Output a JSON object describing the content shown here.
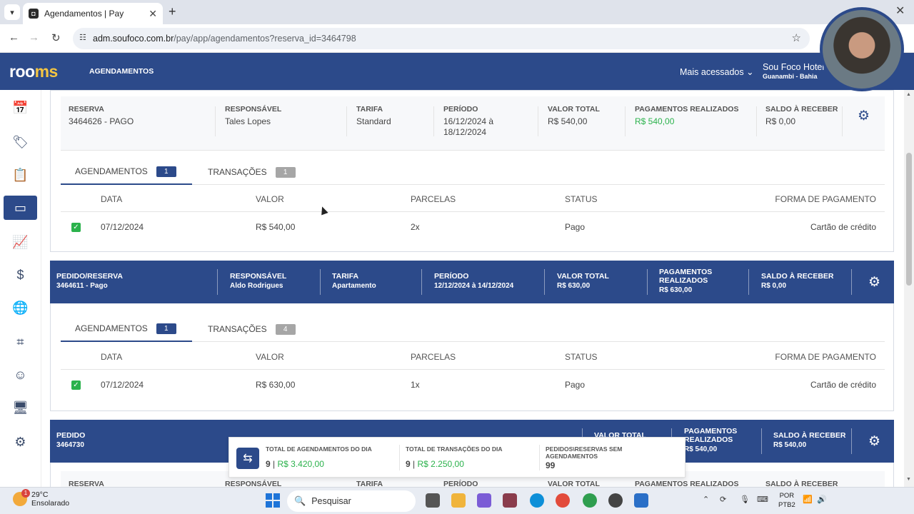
{
  "browser": {
    "tab_title": "Agendamentos | Pay",
    "url_host": "adm.soufoco.com.br",
    "url_path": "/pay/app/agendamentos?reserva_id=3464798"
  },
  "header": {
    "logo_a": "roo",
    "logo_b": "ms",
    "nav_label": "AGENDAMENTOS",
    "mais_acessados": "Mais acessados",
    "hotel_name": "Sou Foco Hotel",
    "hotel_city": "Guanambi - Bahia"
  },
  "card1": {
    "fields": [
      {
        "label": "RESERVA",
        "value": "3464626 - PAGO"
      },
      {
        "label": "RESPONSÁVEL",
        "value": "Tales Lopes"
      },
      {
        "label": "TARIFA",
        "value": "Standard"
      },
      {
        "label": "PERÍODO",
        "value": "16/12/2024 à 18/12/2024"
      },
      {
        "label": "VALOR TOTAL",
        "value": "R$ 540,00"
      },
      {
        "label": "PAGAMENTOS REALIZADOS",
        "value": "R$ 540,00"
      },
      {
        "label": "SALDO À RECEBER",
        "value": "R$ 0,00"
      }
    ],
    "tab_agendamentos": "AGENDAMENTOS",
    "tab_agendamentos_count": "1",
    "tab_transacoes": "TRANSAÇÕES",
    "tab_transacoes_count": "1",
    "columns": [
      "DATA",
      "VALOR",
      "PARCELAS",
      "STATUS",
      "FORMA DE PAGAMENTO"
    ],
    "row": {
      "data": "07/12/2024",
      "valor": "R$ 540,00",
      "parcelas": "2x",
      "status": "Pago",
      "forma": "Cartão de crédito"
    }
  },
  "card2": {
    "fields": [
      {
        "label": "PEDIDO/RESERVA",
        "value": "3464611 - Pago"
      },
      {
        "label": "RESPONSÁVEL",
        "value": "Aldo Rodrigues"
      },
      {
        "label": "TARIFA",
        "value": "Apartamento"
      },
      {
        "label": "PERÍODO",
        "value": "12/12/2024 à 14/12/2024"
      },
      {
        "label": "VALOR TOTAL",
        "value": "R$ 630,00"
      },
      {
        "label": "PAGAMENTOS REALIZADOS",
        "value": "R$ 630,00"
      },
      {
        "label": "SALDO À RECEBER",
        "value": "R$ 0,00"
      }
    ],
    "tab_agendamentos": "AGENDAMENTOS",
    "tab_agendamentos_count": "1",
    "tab_transacoes": "TRANSAÇÕES",
    "tab_transacoes_count": "4",
    "columns": [
      "DATA",
      "VALOR",
      "PARCELAS",
      "STATUS",
      "FORMA DE PAGAMENTO"
    ],
    "row": {
      "data": "07/12/2024",
      "valor": "R$ 630,00",
      "parcelas": "1x",
      "status": "Pago",
      "forma": "Cartão de crédito"
    }
  },
  "card3": {
    "pedido_label": "PEDIDO",
    "pedido_value": "3464730",
    "valor_total_label": "VALOR TOTAL",
    "pagamentos_label": "PAGAMENTOS REALIZADOS",
    "pagamentos_value": "R$ 540,00",
    "saldo_label": "SALDO À RECEBER",
    "saldo_value": "R$ 540,00",
    "sub_labels": [
      "RESERVA",
      "RESPONSÁVEL",
      "TARIFA",
      "PERÍODO",
      "VALOR TOTAL",
      "PAGAMENTOS REALIZADOS",
      "SALDO À RECEBER"
    ]
  },
  "summary": {
    "agend_label": "TOTAL DE AGENDAMENTOS DO DIA",
    "agend_count": "9",
    "agend_value": "R$ 3.420,00",
    "trans_label": "TOTAL DE TRANSAÇÕES DO DIA",
    "trans_count": "9",
    "trans_value": "R$ 2.250,00",
    "sem_label": "PEDIDOS\\RESERVAS SEM AGENDAMENTOS",
    "sem_value": "99"
  },
  "taskbar": {
    "temp": "29°C",
    "weather": "Ensolarado",
    "weather_badge": "1",
    "search": "Pesquisar",
    "lang1": "POR",
    "lang2": "PTB2"
  },
  "icons": [
    "calendar-check-icon",
    "tag-icon",
    "clipboard-icon",
    "card-check-icon",
    "chart-icon",
    "dollar-icon",
    "globe-icon",
    "qr-icon",
    "smile-icon",
    "monitor-icon",
    "user-gear-icon"
  ]
}
